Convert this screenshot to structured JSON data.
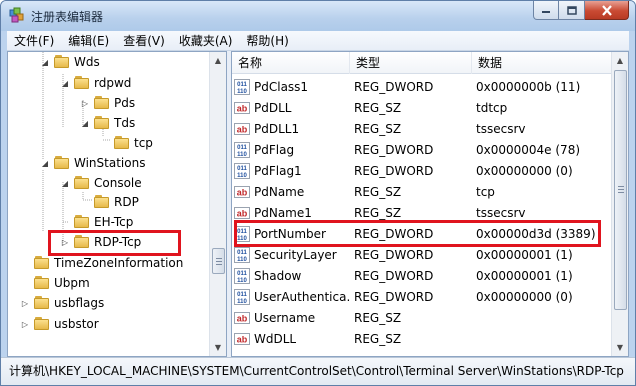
{
  "window": {
    "title": "注册表编辑器"
  },
  "menu": [
    "文件(F)",
    "编辑(E)",
    "查看(V)",
    "收藏夹(A)",
    "帮助(H)"
  ],
  "tree": [
    {
      "label": "Wds",
      "level": 1,
      "expander": "open"
    },
    {
      "label": "rdpwd",
      "level": 2,
      "expander": "open"
    },
    {
      "label": "Pds",
      "level": 3,
      "expander": "closed"
    },
    {
      "label": "Tds",
      "level": 3,
      "expander": "open"
    },
    {
      "label": "tcp",
      "level": 4,
      "expander": "none"
    },
    {
      "label": "WinStations",
      "level": 1,
      "expander": "open"
    },
    {
      "label": "Console",
      "level": 2,
      "expander": "open"
    },
    {
      "label": "RDP",
      "level": 3,
      "expander": "none"
    },
    {
      "label": "EH-Tcp",
      "level": 2,
      "expander": "none"
    },
    {
      "label": "RDP-Tcp",
      "level": 2,
      "expander": "closed"
    },
    {
      "label": "TimeZoneInformation",
      "level": 0,
      "expander": "none"
    },
    {
      "label": "Ubpm",
      "level": 0,
      "expander": "none"
    },
    {
      "label": "usbflags",
      "level": 0,
      "expander": "closed"
    },
    {
      "label": "usbstor",
      "level": 0,
      "expander": "closed"
    }
  ],
  "list": {
    "headers": {
      "name": "名称",
      "type": "类型",
      "data": "数据"
    },
    "rows": [
      {
        "name": "PdClass1",
        "type": "REG_DWORD",
        "data": "0x0000000b (11)",
        "icon": "dword-value-icon"
      },
      {
        "name": "PdDLL",
        "type": "REG_SZ",
        "data": "tdtcp",
        "icon": "string-value-icon"
      },
      {
        "name": "PdDLL1",
        "type": "REG_SZ",
        "data": "tssecsrv",
        "icon": "string-value-icon"
      },
      {
        "name": "PdFlag",
        "type": "REG_DWORD",
        "data": "0x0000004e (78)",
        "icon": "dword-value-icon"
      },
      {
        "name": "PdFlag1",
        "type": "REG_DWORD",
        "data": "0x00000000 (0)",
        "icon": "dword-value-icon"
      },
      {
        "name": "PdName",
        "type": "REG_SZ",
        "data": "tcp",
        "icon": "string-value-icon"
      },
      {
        "name": "PdName1",
        "type": "REG_SZ",
        "data": "tssecsrv",
        "icon": "string-value-icon"
      },
      {
        "name": "PortNumber",
        "type": "REG_DWORD",
        "data": "0x00000d3d (3389)",
        "icon": "dword-value-icon"
      },
      {
        "name": "SecurityLayer",
        "type": "REG_DWORD",
        "data": "0x00000001 (1)",
        "icon": "dword-value-icon"
      },
      {
        "name": "Shadow",
        "type": "REG_DWORD",
        "data": "0x00000001 (1)",
        "icon": "dword-value-icon"
      },
      {
        "name": "UserAuthentica...",
        "type": "REG_DWORD",
        "data": "0x00000000 (0)",
        "icon": "dword-value-icon"
      },
      {
        "name": "Username",
        "type": "REG_SZ",
        "data": "",
        "icon": "string-value-icon"
      },
      {
        "name": "WdDLL",
        "type": "REG_SZ",
        "data": "",
        "icon": "string-value-icon"
      }
    ]
  },
  "status": {
    "path": "计算机\\HKEY_LOCAL_MACHINE\\SYSTEM\\CurrentControlSet\\Control\\Terminal Server\\WinStations\\RDP-Tcp"
  },
  "colors": {
    "highlight": "#e0141e",
    "folder": "#f3c95d"
  }
}
